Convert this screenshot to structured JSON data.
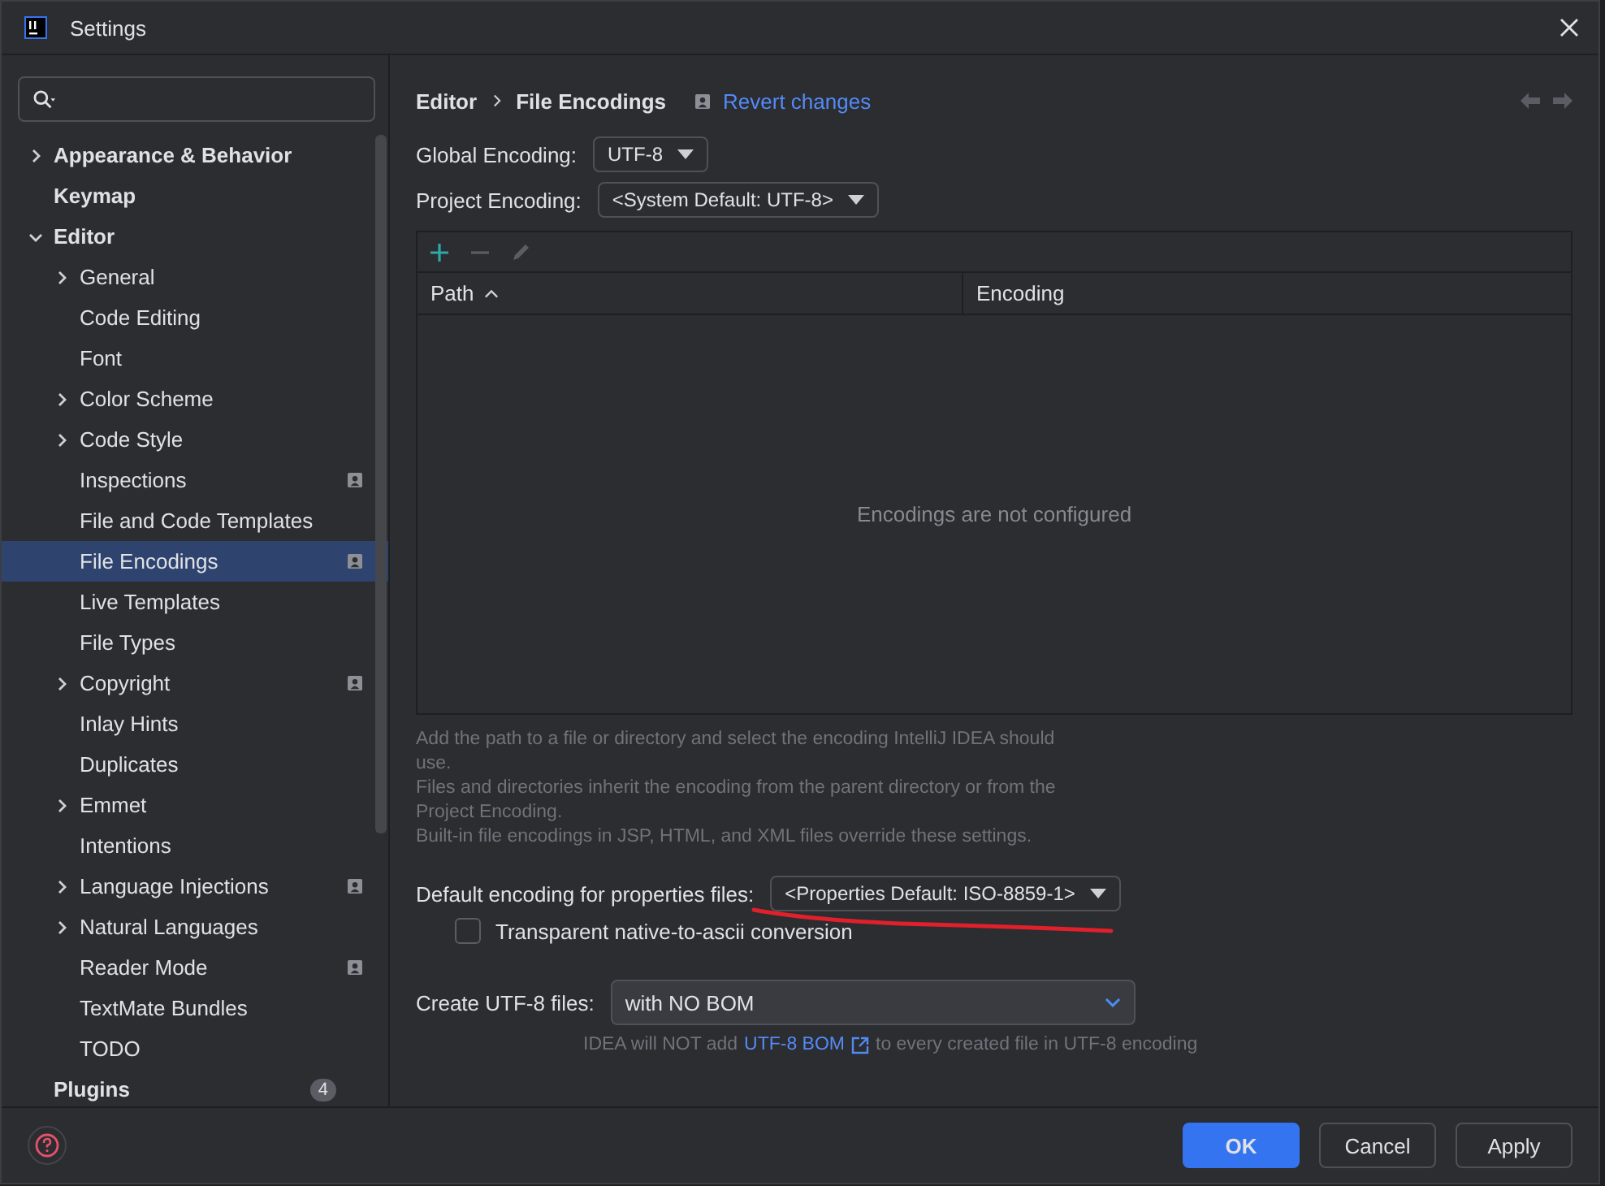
{
  "window": {
    "title": "Settings"
  },
  "sidebar": {
    "items": [
      {
        "label": "Appearance & Behavior",
        "bold": true,
        "expanded": false,
        "selected": false
      },
      {
        "label": "Keymap",
        "bold": true,
        "selected": false
      },
      {
        "label": "Editor",
        "bold": true,
        "expanded": true,
        "selected": false,
        "children": [
          {
            "label": "General",
            "expanded": false,
            "selected": false
          },
          {
            "label": "Code Editing",
            "selected": false
          },
          {
            "label": "Font",
            "selected": false
          },
          {
            "label": "Color Scheme",
            "expanded": false,
            "selected": false
          },
          {
            "label": "Code Style",
            "expanded": false,
            "selected": false
          },
          {
            "label": "Inspections",
            "project_scope": true,
            "selected": false
          },
          {
            "label": "File and Code Templates",
            "selected": false
          },
          {
            "label": "File Encodings",
            "project_scope": true,
            "selected": true
          },
          {
            "label": "Live Templates",
            "selected": false
          },
          {
            "label": "File Types",
            "selected": false
          },
          {
            "label": "Copyright",
            "expanded": false,
            "project_scope": true,
            "selected": false
          },
          {
            "label": "Inlay Hints",
            "selected": false
          },
          {
            "label": "Duplicates",
            "selected": false
          },
          {
            "label": "Emmet",
            "expanded": false,
            "selected": false
          },
          {
            "label": "Intentions",
            "selected": false
          },
          {
            "label": "Language Injections",
            "expanded": false,
            "project_scope": true,
            "selected": false
          },
          {
            "label": "Natural Languages",
            "expanded": false,
            "selected": false
          },
          {
            "label": "Reader Mode",
            "project_scope": true,
            "selected": false
          },
          {
            "label": "TextMate Bundles",
            "selected": false
          },
          {
            "label": "TODO",
            "selected": false
          }
        ]
      },
      {
        "label": "Plugins",
        "bold": true,
        "count": "4",
        "selected": false
      }
    ]
  },
  "breadcrumb": [
    "Editor",
    "File Encodings"
  ],
  "revert_link": "Revert changes",
  "global_encoding": {
    "label": "Global Encoding:",
    "value": "UTF-8"
  },
  "project_encoding": {
    "label": "Project Encoding:",
    "value": "<System Default: UTF-8>"
  },
  "table": {
    "columns": [
      "Path",
      "Encoding"
    ],
    "empty_text": "Encodings are not configured"
  },
  "help_lines": [
    "Add the path to a file or directory and select the encoding IntelliJ IDEA should use.",
    "Files and directories inherit the encoding from the parent directory or from the Project Encoding.",
    "Built-in file encodings in JSP, HTML, and XML files override these settings."
  ],
  "properties_encoding": {
    "label": "Default encoding for properties files:",
    "value": "<Properties Default: ISO-8859-1>"
  },
  "native_to_ascii": {
    "label": "Transparent native-to-ascii conversion",
    "checked": false
  },
  "create_utf8": {
    "label": "Create UTF-8 files:",
    "value": "with NO BOM"
  },
  "bom_note": {
    "before": "IDEA will NOT add",
    "link": "UTF-8 BOM",
    "after": "to every created file in UTF-8 encoding"
  },
  "buttons": [
    "OK",
    "Cancel",
    "Apply"
  ]
}
